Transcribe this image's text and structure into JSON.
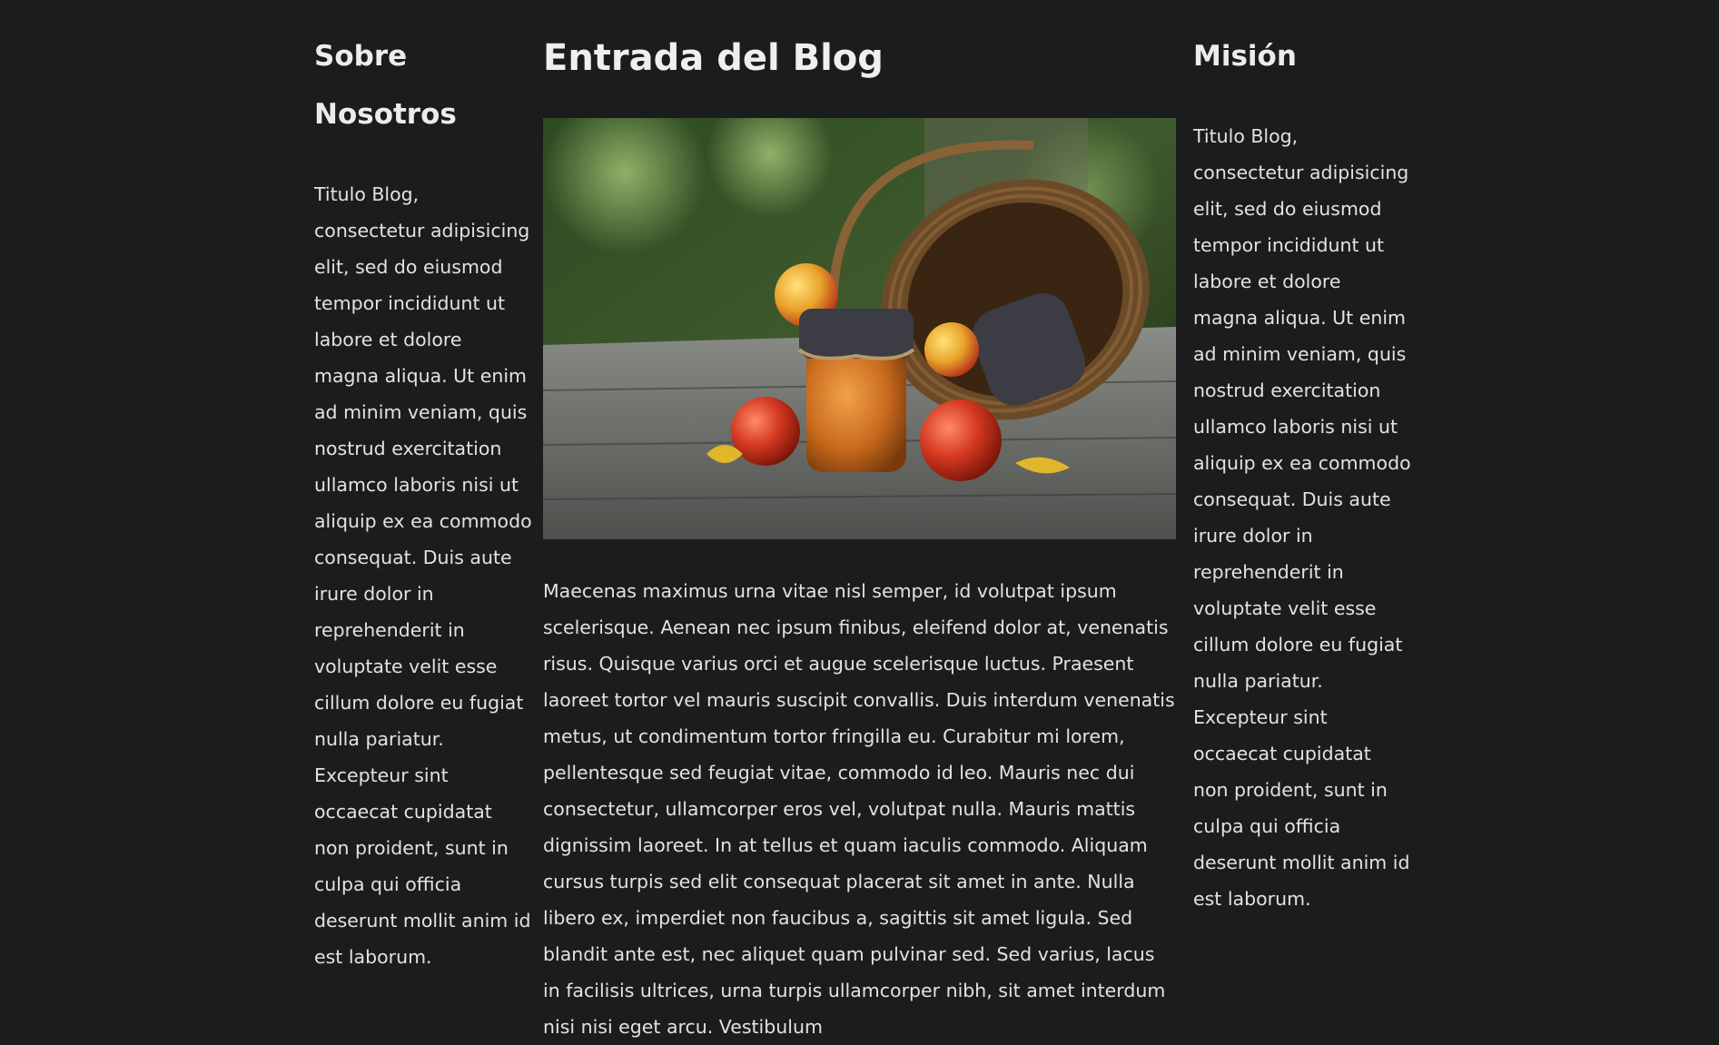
{
  "left": {
    "title": "Sobre Nosotros",
    "text": "Titulo Blog, consectetur adipisicing elit, sed do eiusmod tempor incididunt ut labore et dolore magna aliqua. Ut enim ad minim veniam, quis nostrud exercitation ullamco laboris nisi ut aliquip ex ea commodo consequat. Duis aute irure dolor in reprehenderit in voluptate velit esse cillum dolore eu fugiat nulla pariatur. Excepteur sint occaecat cupidatat non proident, sunt in culpa qui officia deserunt mollit anim id est laborum."
  },
  "main": {
    "title": "Entrada del Blog",
    "image_icon": "photo-basket-apples-jam",
    "text": "Maecenas maximus urna vitae nisl semper, id volutpat ipsum scelerisque. Aenean nec ipsum finibus, eleifend dolor at, venenatis risus. Quisque varius orci et augue scelerisque luctus. Praesent laoreet tortor vel mauris suscipit convallis. Duis interdum venenatis metus, ut condimentum tortor fringilla eu. Curabitur mi lorem, pellentesque sed feugiat vitae, commodo id leo. Mauris nec dui consectetur, ullamcorper eros vel, volutpat nulla. Mauris mattis dignissim laoreet. In at tellus et quam iaculis commodo. Aliquam cursus turpis sed elit consequat placerat sit amet in ante. Nulla libero ex, imperdiet non faucibus a, sagittis sit amet ligula. Sed blandit ante est, nec aliquet quam pulvinar sed. Sed varius, lacus in facilisis ultrices, urna turpis ullamcorper nibh, sit amet interdum nisi nisi eget arcu. Vestibulum"
  },
  "right": {
    "title": "Misión",
    "text": "Titulo Blog, consectetur adipisicing elit, sed do eiusmod tempor incididunt ut labore et dolore magna aliqua. Ut enim ad minim veniam, quis nostrud exercitation ullamco laboris nisi ut aliquip ex ea commodo consequat. Duis aute irure dolor in reprehenderit in voluptate velit esse cillum dolore eu fugiat nulla pariatur. Excepteur sint occaecat cupidatat non proident, sunt in culpa qui officia deserunt mollit anim id est laborum."
  },
  "colors": {
    "background": "#1b1c1e",
    "text": "#e2e2e2",
    "heading": "#ececec"
  }
}
